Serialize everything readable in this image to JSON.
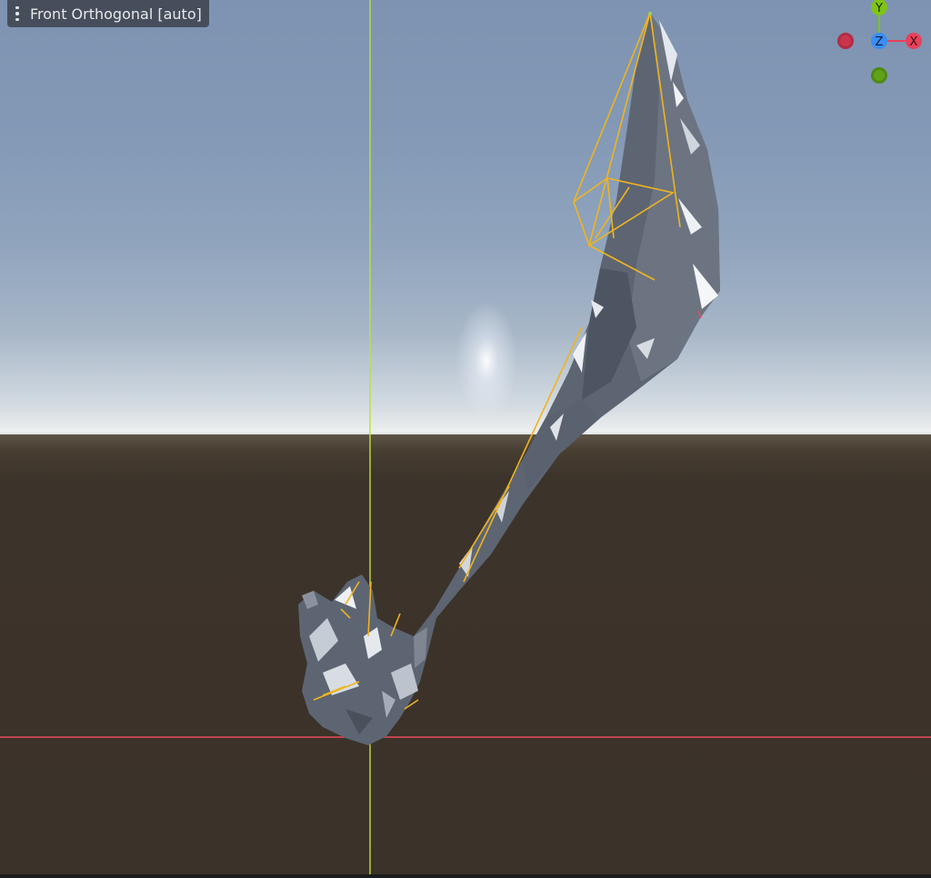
{
  "viewport": {
    "view_label": "Front Orthogonal [auto]",
    "menu_icon": "kebab-menu-icon"
  },
  "gizmo": {
    "y_label": "Y",
    "z_label": "Z",
    "x_label": "X",
    "colors": {
      "x_axis": "#e8415c",
      "y_axis": "#7dc416",
      "z_axis": "#3a8ef5"
    }
  },
  "scene": {
    "colors": {
      "x_axis_line": "#e84a5f",
      "y_axis_line": "#b8e33b",
      "bone_lines": "#f0b41e",
      "mesh": "#5b6370",
      "sky_top": "#7d93b1",
      "ground": "#3b3229"
    }
  }
}
